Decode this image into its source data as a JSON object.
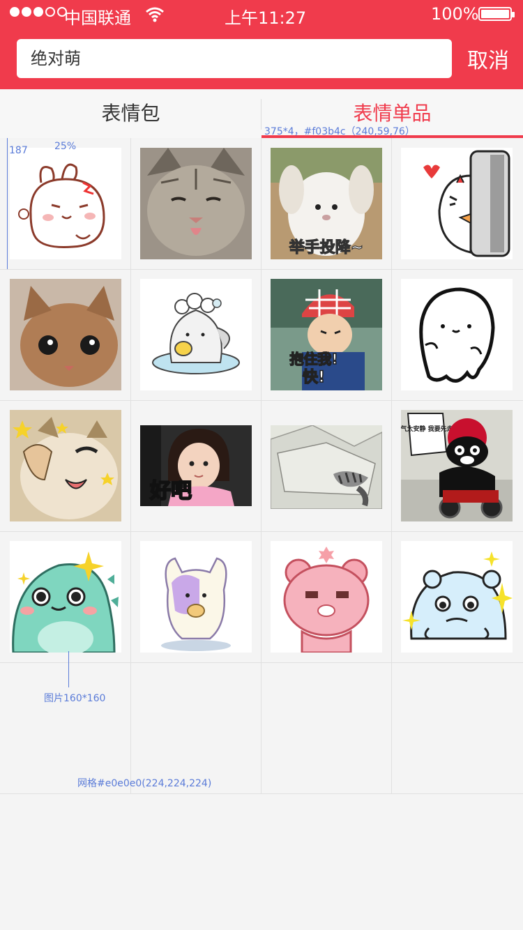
{
  "status_bar": {
    "carrier": "中国联通",
    "time": "上午11:27",
    "battery": "100%"
  },
  "search": {
    "query": "绝对萌",
    "cancel_label": "取消"
  },
  "tabs": [
    {
      "label": "表情包",
      "active": false
    },
    {
      "label": "表情单品",
      "active": true
    }
  ],
  "annotations": {
    "tab_spec": "375*4，#f03b4c（240,59,76）",
    "cell_width": "187",
    "image_offset": "25%",
    "image_size": "图片160*160",
    "grid_color": "网格#e0e0e0(224,224,224)"
  },
  "captions": {
    "surrender": "举手投降~",
    "hug": "抱住我!",
    "fast": "快!",
    "okay": "好吧",
    "bubble": "空气太安静 我要先走了"
  },
  "colors": {
    "accent": "#f03b4c",
    "grid": "#e0e0e0",
    "annotation": "#5a7bd8"
  }
}
